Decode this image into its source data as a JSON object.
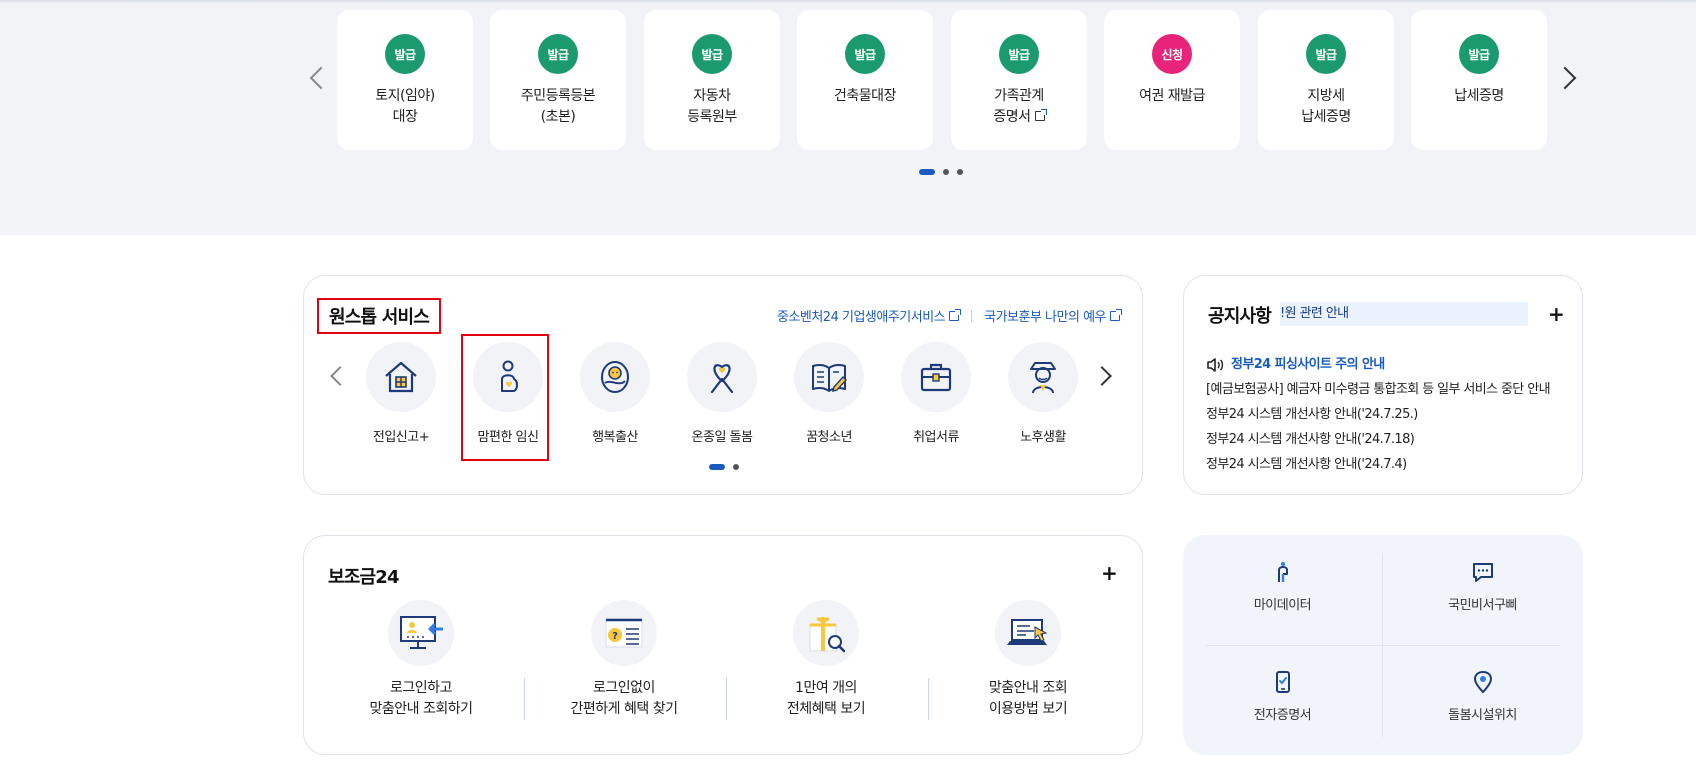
{
  "colors": {
    "issue_green": "#1b9a6e",
    "apply_pink": "#e8247a",
    "accent_blue": "#1a5bbf",
    "highlight_red": "#e60012"
  },
  "doc_carousel": {
    "items": [
      {
        "badge": "발급",
        "label": "토지(임야)\n대장",
        "badge_color": "#1b9a6e"
      },
      {
        "badge": "발급",
        "label": "주민등록등본\n(초본)",
        "badge_color": "#1b9a6e"
      },
      {
        "badge": "발급",
        "label": "자동차\n등록원부",
        "badge_color": "#1b9a6e"
      },
      {
        "badge": "발급",
        "label": "건축물대장",
        "badge_color": "#1b9a6e"
      },
      {
        "badge": "발급",
        "label": "가족관계\n증명서",
        "badge_color": "#1b9a6e"
      },
      {
        "badge": "신청",
        "label": "여권 재발급",
        "badge_color": "#e8247a"
      },
      {
        "badge": "발급",
        "label": "지방세\n납세증명",
        "badge_color": "#1b9a6e"
      },
      {
        "badge": "발급",
        "label": "납세증명",
        "badge_color": "#1b9a6e"
      }
    ]
  },
  "onestop": {
    "title": "원스톱 서비스",
    "links": [
      "중소벤처24 기업생애주기서비스",
      "국가보훈부 나만의 예우"
    ],
    "items": [
      {
        "label": "전입신고+",
        "icon": "house-icon"
      },
      {
        "label": "맘편한 임신",
        "icon": "pregnancy-icon"
      },
      {
        "label": "행복출산",
        "icon": "baby-icon"
      },
      {
        "label": "온종일 돌봄",
        "icon": "ribbon-heart-icon"
      },
      {
        "label": "꿈청소년",
        "icon": "book-pen-icon"
      },
      {
        "label": "취업서류",
        "icon": "briefcase-icon"
      },
      {
        "label": "노후생활",
        "icon": "elder-icon"
      }
    ]
  },
  "notice": {
    "title": "공지사항",
    "search_text": "!원 관련 안내",
    "items": [
      "정부24 피싱사이트 주의 안내",
      "[예금보험공사] 예금자 미수령금 통합조회 등 일부 서비스 중단 안내",
      "정부24 시스템 개선사항 안내('24.7.25.)",
      "정부24 시스템 개선사항 안내('24.7.18)",
      "정부24 시스템 개선사항 안내('24.7.4)"
    ]
  },
  "subsidy": {
    "title": "보조금24",
    "items": [
      {
        "label": "로그인하고\n맞춤안내 조회하기",
        "icon": "monitor-login-icon"
      },
      {
        "label": "로그인없이\n간편하게 혜택 찾기",
        "icon": "question-list-icon"
      },
      {
        "label": "1만여 개의\n전체혜택 보기",
        "icon": "gift-search-icon"
      },
      {
        "label": "맞춤안내 조회\n이용방법 보기",
        "icon": "laptop-cursor-icon"
      }
    ]
  },
  "quick_menu": {
    "items": [
      {
        "label": "마이데이터",
        "icon": "mydata-icon"
      },
      {
        "label": "국민비서구삐",
        "icon": "chat-bubble-icon"
      },
      {
        "label": "전자증명서",
        "icon": "mobile-cert-icon"
      },
      {
        "label": "돌봄시설위치",
        "icon": "location-pin-icon"
      }
    ]
  }
}
